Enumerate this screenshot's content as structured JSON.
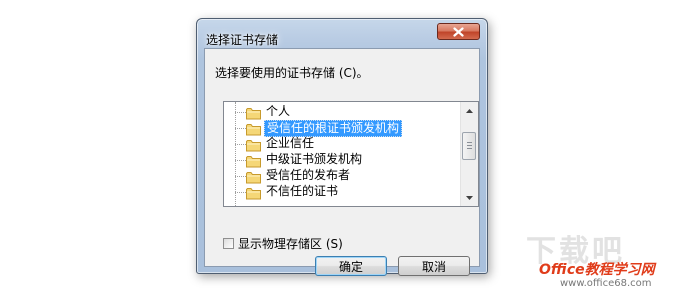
{
  "dialog": {
    "title": "选择证书存储",
    "prompt": "选择要使用的证书存储 (C)。",
    "tree_items": [
      {
        "label": "个人",
        "selected": false
      },
      {
        "label": "受信任的根证书颁发机构",
        "selected": true
      },
      {
        "label": "企业信任",
        "selected": false
      },
      {
        "label": "中级证书颁发机构",
        "selected": false
      },
      {
        "label": "受信任的发布者",
        "selected": false
      },
      {
        "label": "不信任的证书",
        "selected": false
      }
    ],
    "show_physical_label": "显示物理存储区 (S)",
    "show_physical_checked": false,
    "ok_label": "确定",
    "cancel_label": "取消"
  },
  "watermark": {
    "main": "下载吧",
    "brand": "Office教程学习网",
    "url": "www.office68.com"
  },
  "colors": {
    "selection": "#3399ff",
    "close_button": "#c0452a",
    "watermark_brand": "#e03c1a"
  }
}
